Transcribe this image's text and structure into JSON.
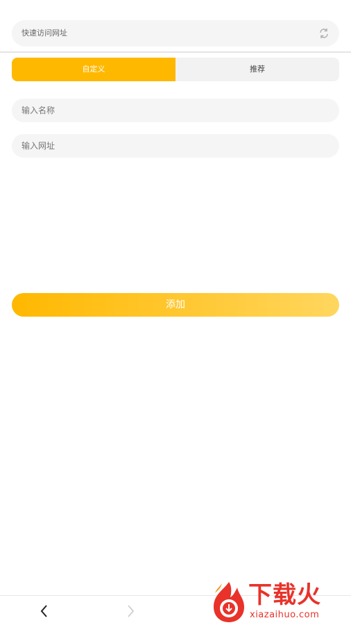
{
  "quick_access": {
    "label": "快速访问网址",
    "icon": "refresh-icon"
  },
  "tabs": [
    {
      "label": "自定义",
      "active": true
    },
    {
      "label": "推荐",
      "active": false
    }
  ],
  "form": {
    "name_placeholder": "输入名称",
    "url_placeholder": "输入网址",
    "name_value": "",
    "url_value": ""
  },
  "add_button": {
    "label": "添加"
  },
  "bottom_nav": {
    "back_icon": "chevron-left-icon",
    "forward_icon": "chevron-right-icon"
  },
  "watermark": {
    "title": "下载火",
    "subtitle": "xiazaihuo.com"
  },
  "colors": {
    "accent": "#ffb800",
    "accent_light": "#ffd65e",
    "brand_red": "#e8322a",
    "field_bg": "#f5f5f5"
  }
}
